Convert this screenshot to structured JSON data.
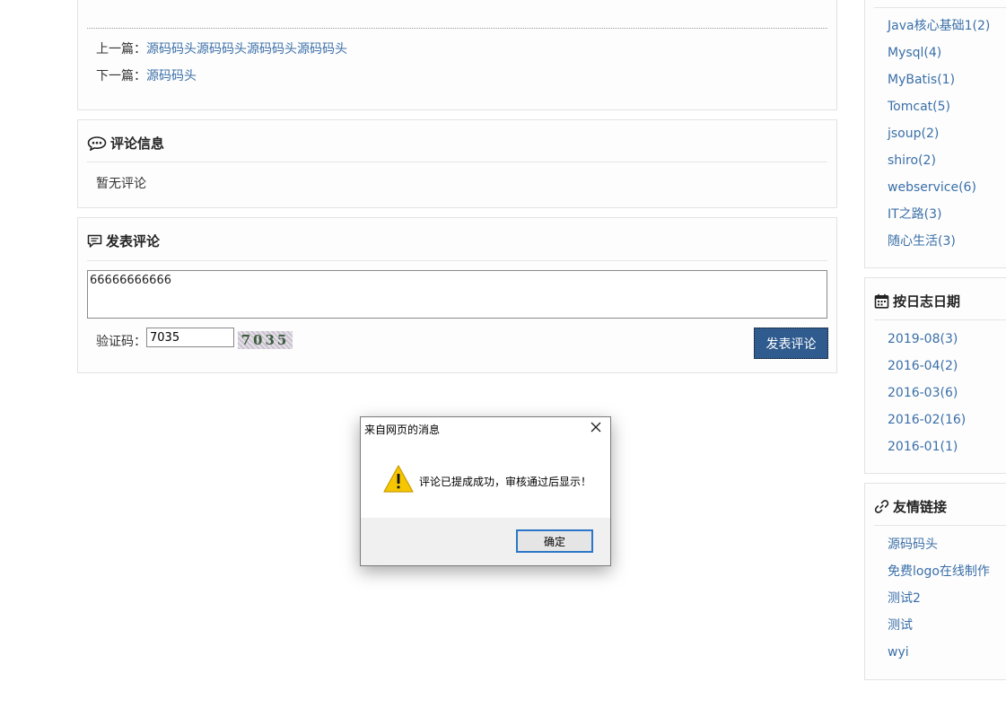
{
  "article_nav": {
    "prev_label": "上一篇：",
    "prev_title": "源码码头源码码头源码码头源码码头",
    "next_label": "下一篇：",
    "next_title": "源码码头"
  },
  "comments": {
    "title": "评论信息",
    "empty_text": "暂无评论"
  },
  "post_comment": {
    "title": "发表评论",
    "textarea_value": "66666666666",
    "captcha_label": "验证码：",
    "captcha_value": "7035",
    "captcha_image_text": "7035",
    "submit_label": "发表评论"
  },
  "sidebar": {
    "categories": [
      "Java核心基础1(2)",
      "Mysql(4)",
      "MyBatis(1)",
      "Tomcat(5)",
      "jsoup(2)",
      "shiro(2)",
      "webservice(6)",
      "IT之路(3)",
      "随心生活(3)"
    ],
    "dates_title": "按日志日期",
    "dates": [
      "2019-08(3)",
      "2016-04(2)",
      "2016-03(6)",
      "2016-02(16)",
      "2016-01(1)"
    ],
    "links_title": "友情链接",
    "links": [
      "源码码头",
      "免费logo在线制作",
      "测试2",
      "测试",
      "wyi"
    ]
  },
  "dialog": {
    "title": "来自网页的消息",
    "message": "评论已提成成功，审核通过后显示！",
    "ok_label": "确定",
    "icon": "warning-icon"
  },
  "colors": {
    "link": "#3a6fa8",
    "submit_button": "#2f5b8e",
    "dialog_focus": "#2b76c8",
    "warning": "#f6c700"
  }
}
